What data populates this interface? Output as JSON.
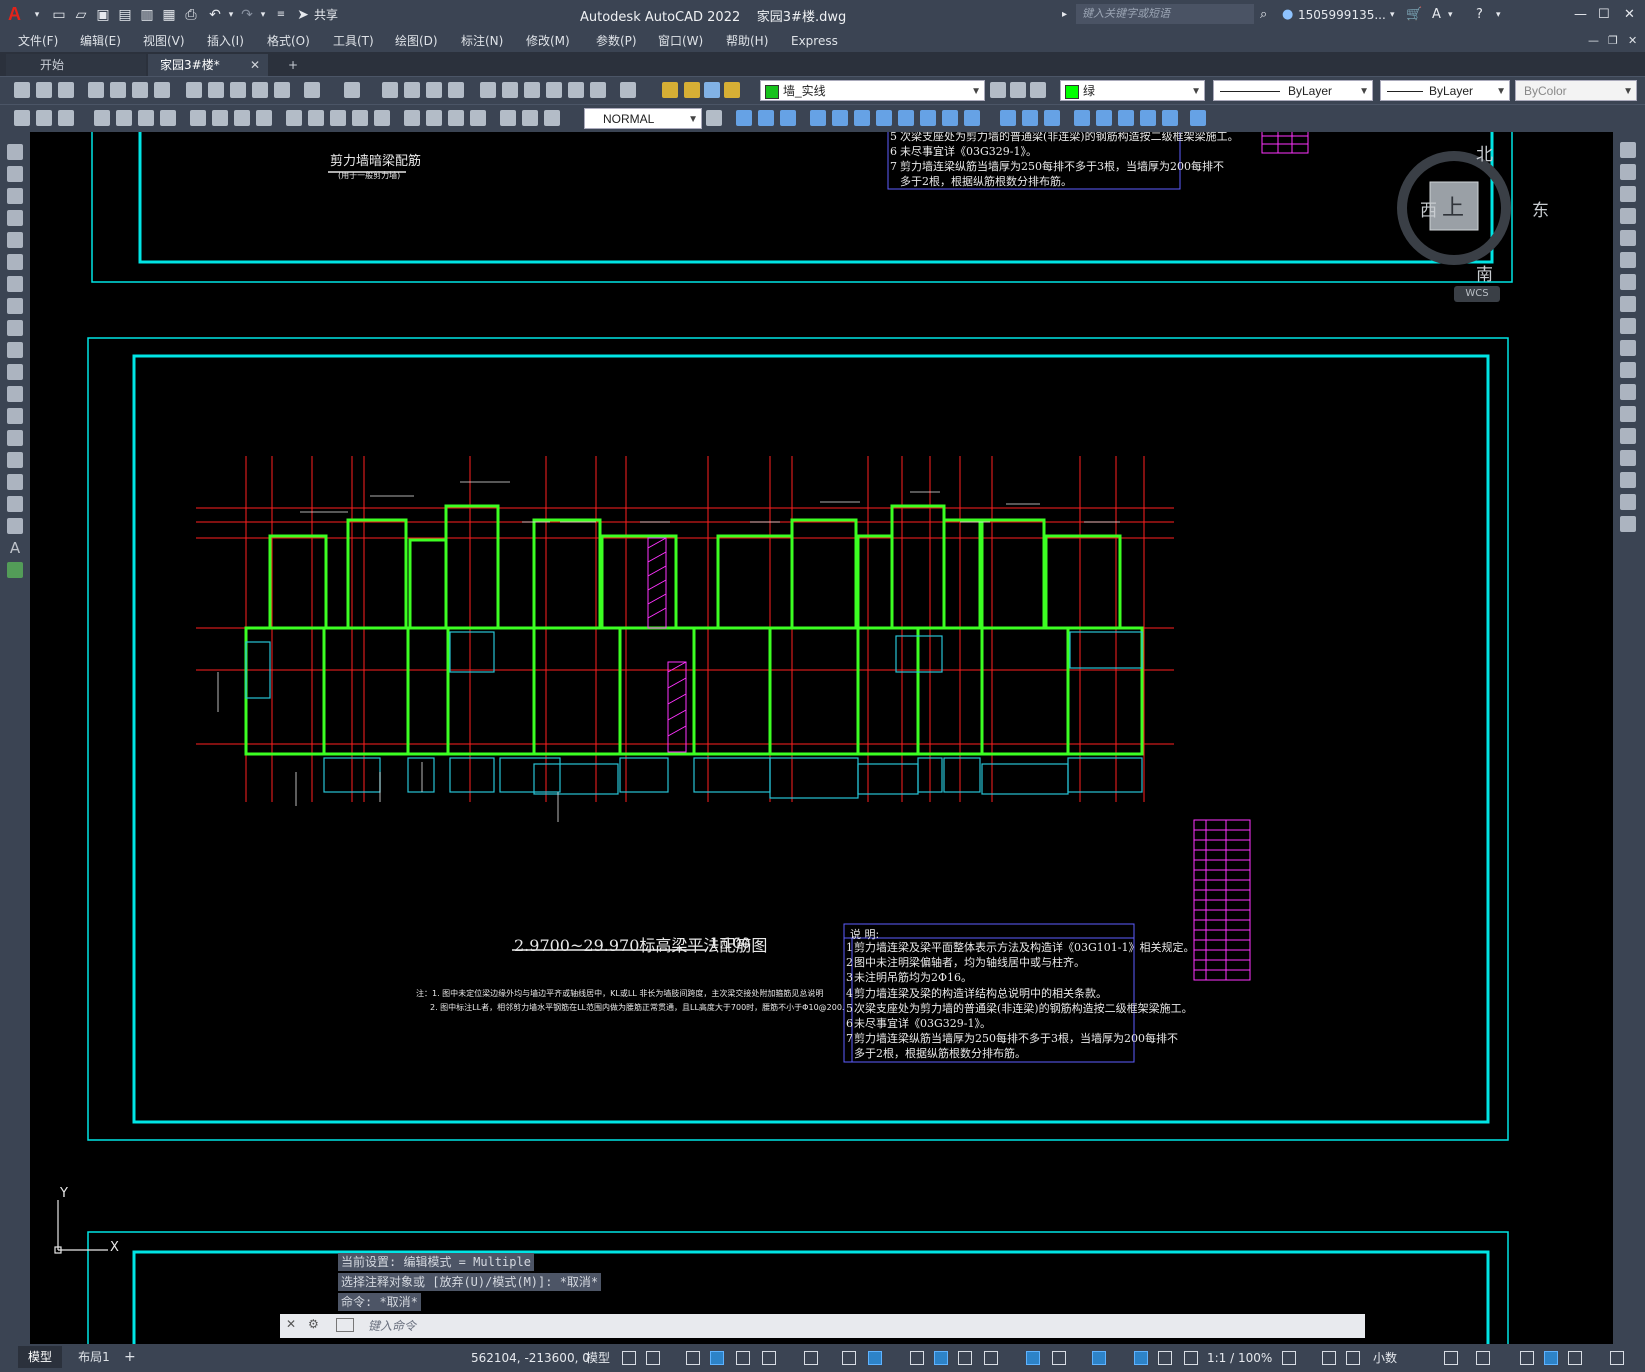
{
  "titlebar": {
    "app_logo": "A",
    "share": "共享",
    "title": "Autodesk AutoCAD 2022    家园3#楼.dwg",
    "search_placeholder": "键入关键字或短语",
    "user": "1505999135...",
    "icons": [
      "new-icon",
      "open-icon",
      "save-icon",
      "saveas-icon",
      "plot-icon",
      "undo-icon",
      "redo-icon",
      "share-icon",
      "cart-icon",
      "help-icon"
    ]
  },
  "menubar": {
    "items": [
      "文件(F)",
      "编辑(E)",
      "视图(V)",
      "插入(I)",
      "格式(O)",
      "工具(T)",
      "绘图(D)",
      "标注(N)",
      "修改(M)",
      "参数(P)",
      "窗口(W)",
      "帮助(H)",
      "Express"
    ]
  },
  "tabs": {
    "start": "开始",
    "file": "家园3#楼*",
    "add": "+"
  },
  "properties": {
    "layer": "墙_实线",
    "color": "绿",
    "linetype": "ByLayer",
    "lineweight": "ByLayer",
    "plotstyle": "ByColor",
    "dimstyle": "NORMAL",
    "colors": {
      "layer_swatch": "#17c21d",
      "green": "#00ff00"
    }
  },
  "viewcube": {
    "north": "北",
    "south": "南",
    "east": "东",
    "west": "西",
    "top": "上",
    "wcs": "WCS"
  },
  "drawing": {
    "top_title": "剪力墙暗梁配筋",
    "top_subtitle": "(用于一般剪力墙)",
    "top_notes": [
      "次梁支座处为剪力墙的普通梁(非连梁)的钢筋构造按二级框架梁施工。",
      "未尽事宜详《03G329-1》。",
      "剪力墙连梁纵筋当墙厚为250每排不多于3根，当墙厚为200每排不",
      "多于2根，根据纵筋根数分排布筋。"
    ],
    "top_note_nums": [
      "5",
      "6",
      "7"
    ],
    "main_title": "2.9700~29.970标高梁平法配筋图",
    "scale": "1:100",
    "note_line1": "注：1. 图中未定位梁边缘外均与墙边平齐或轴线居中，KL或LL 非长为墙肢间跨度，主次梁交接处附加箍筋见总说明",
    "note_line2": "2. 图中标注LL者，相邻剪力墙水平钢筋在LL范围内做为腰筋正常贯通，且LL高度大于700时，腰筋不小于Φ10@200.",
    "notes_header": "说  明:",
    "notes": [
      "剪力墙连梁及梁平面整体表示方法及构造详《03G101-1》相关规定。",
      "图中未注明梁偏轴者，均为轴线居中或与柱齐。",
      "未注明吊筋均为2Φ16。",
      "剪力墙连梁及梁的构造详结构总说明中的相关条款。",
      "次梁支座处为剪力墙的普通梁(非连梁)的钢筋构造按二级框架梁施工。",
      "未尽事宜详《03G329-1》。",
      "剪力墙连梁纵筋当墙厚为250每排不多于3根，当墙厚为200每排不",
      "多于2根，根据纵筋根数分排布筋。"
    ],
    "note_nums": [
      "1",
      "2",
      "3",
      "4",
      "5",
      "6",
      "7"
    ],
    "axis_y": "Y",
    "axis_x": "X"
  },
  "command": {
    "history": [
      "当前设置: 编辑模式 = Multiple",
      "选择注释对象或 [放弃(U)/模式(M)]: *取消*",
      "命令: *取消*"
    ],
    "placeholder": "键入命令"
  },
  "statusbar": {
    "model_tab": "模型",
    "layout_tab": "布局1",
    "add": "+",
    "coords": "562104, -213600, 0",
    "space": "模型",
    "scale": "1:1 / 100%",
    "units": "小数"
  }
}
